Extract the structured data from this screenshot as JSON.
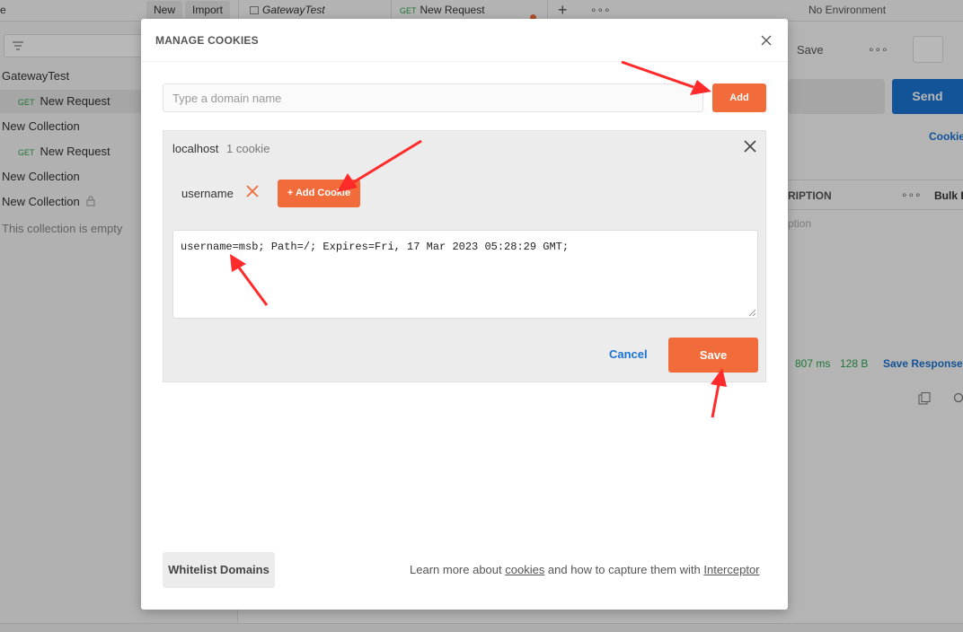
{
  "app": {
    "new_label": "New",
    "import_label": "Import",
    "tab1_label": "GatewayTest",
    "tab2_method": "GET",
    "tab2_label": "New Request",
    "env_label": "No Environment",
    "save_label": "Save",
    "send_label": "Send",
    "cookies_link": "Cookie",
    "desc_header": "RIPTION",
    "bulk_edit": "Bulk E",
    "desc_placeholder": "ption",
    "time": "807 ms",
    "size": "128 B",
    "save_response": "Save Response"
  },
  "sidebar": {
    "items": [
      {
        "label": "GatewayTest"
      },
      {
        "method": "GET",
        "label": "New Request"
      },
      {
        "label": "New Collection"
      },
      {
        "method": "GET",
        "label": "New Request"
      },
      {
        "label": "New Collection"
      },
      {
        "label": "New Collection"
      },
      {
        "label": "This collection is empty"
      }
    ]
  },
  "modal": {
    "title": "MANAGE COOKIES",
    "domain_placeholder": "Type a domain name",
    "add_label": "Add",
    "domain": {
      "name": "localhost",
      "count": "1 cookie",
      "cookie_name": "username",
      "add_cookie_label": "+ Add Cookie",
      "cookie_value": "username=msb; Path=/; Expires=Fri, 17 Mar 2023 05:28:29 GMT;"
    },
    "cancel_label": "Cancel",
    "save_label": "Save",
    "whitelist_label": "Whitelist Domains",
    "footer": {
      "prefix": "Learn more about ",
      "link1": "cookies",
      "middle": " and how to capture them with ",
      "link2": "Interceptor"
    }
  },
  "colors": {
    "accent": "#f26b3a",
    "link": "#1b73d1",
    "annotation_arrow": "#ff2a2a"
  }
}
